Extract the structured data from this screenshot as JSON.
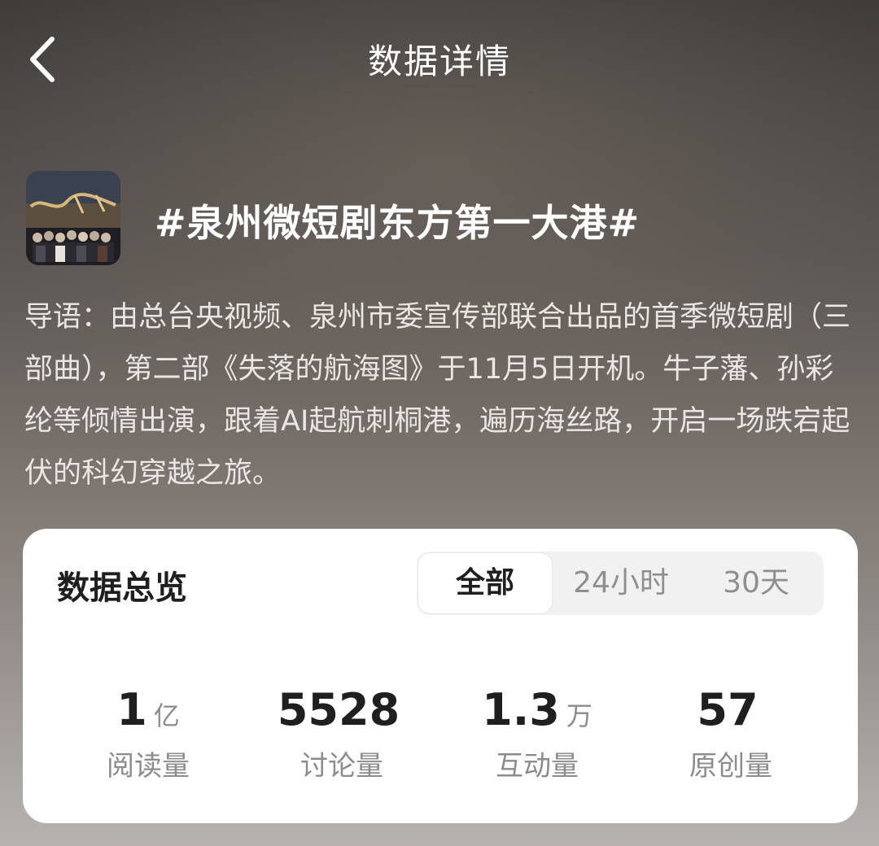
{
  "header": {
    "back_icon": "chevron-left-icon",
    "title": "数据详情"
  },
  "topic": {
    "thumbnail": "drama-poster-thumbnail",
    "title": "#泉州微短剧东方第一大港#"
  },
  "intro": {
    "text": "导语：由总台央视频、泉州市委宣传部联合出品的首季微短剧（三部曲），第二部《失落的航海图》于11月5日开机。牛子藩、孙彩纶等倾情出演，跟着AI起航刺桐港，遍历海丝路，开启一场跌宕起伏的科幻穿越之旅。"
  },
  "overview": {
    "title": "数据总览",
    "tabs": [
      {
        "label": "全部",
        "active": true
      },
      {
        "label": "24小时",
        "active": false
      },
      {
        "label": "30天",
        "active": false
      }
    ],
    "stats": [
      {
        "value": "1",
        "unit": "亿",
        "label": "阅读量"
      },
      {
        "value": "5528",
        "unit": "",
        "label": "讨论量"
      },
      {
        "value": "1.3",
        "unit": "万",
        "label": "互动量"
      },
      {
        "value": "57",
        "unit": "",
        "label": "原创量"
      }
    ]
  },
  "colors": {
    "card_bg": "#ffffff",
    "text_primary": "#1f1f1f",
    "text_secondary": "#8c8c8c",
    "segment_bg": "#f1f1f1"
  }
}
